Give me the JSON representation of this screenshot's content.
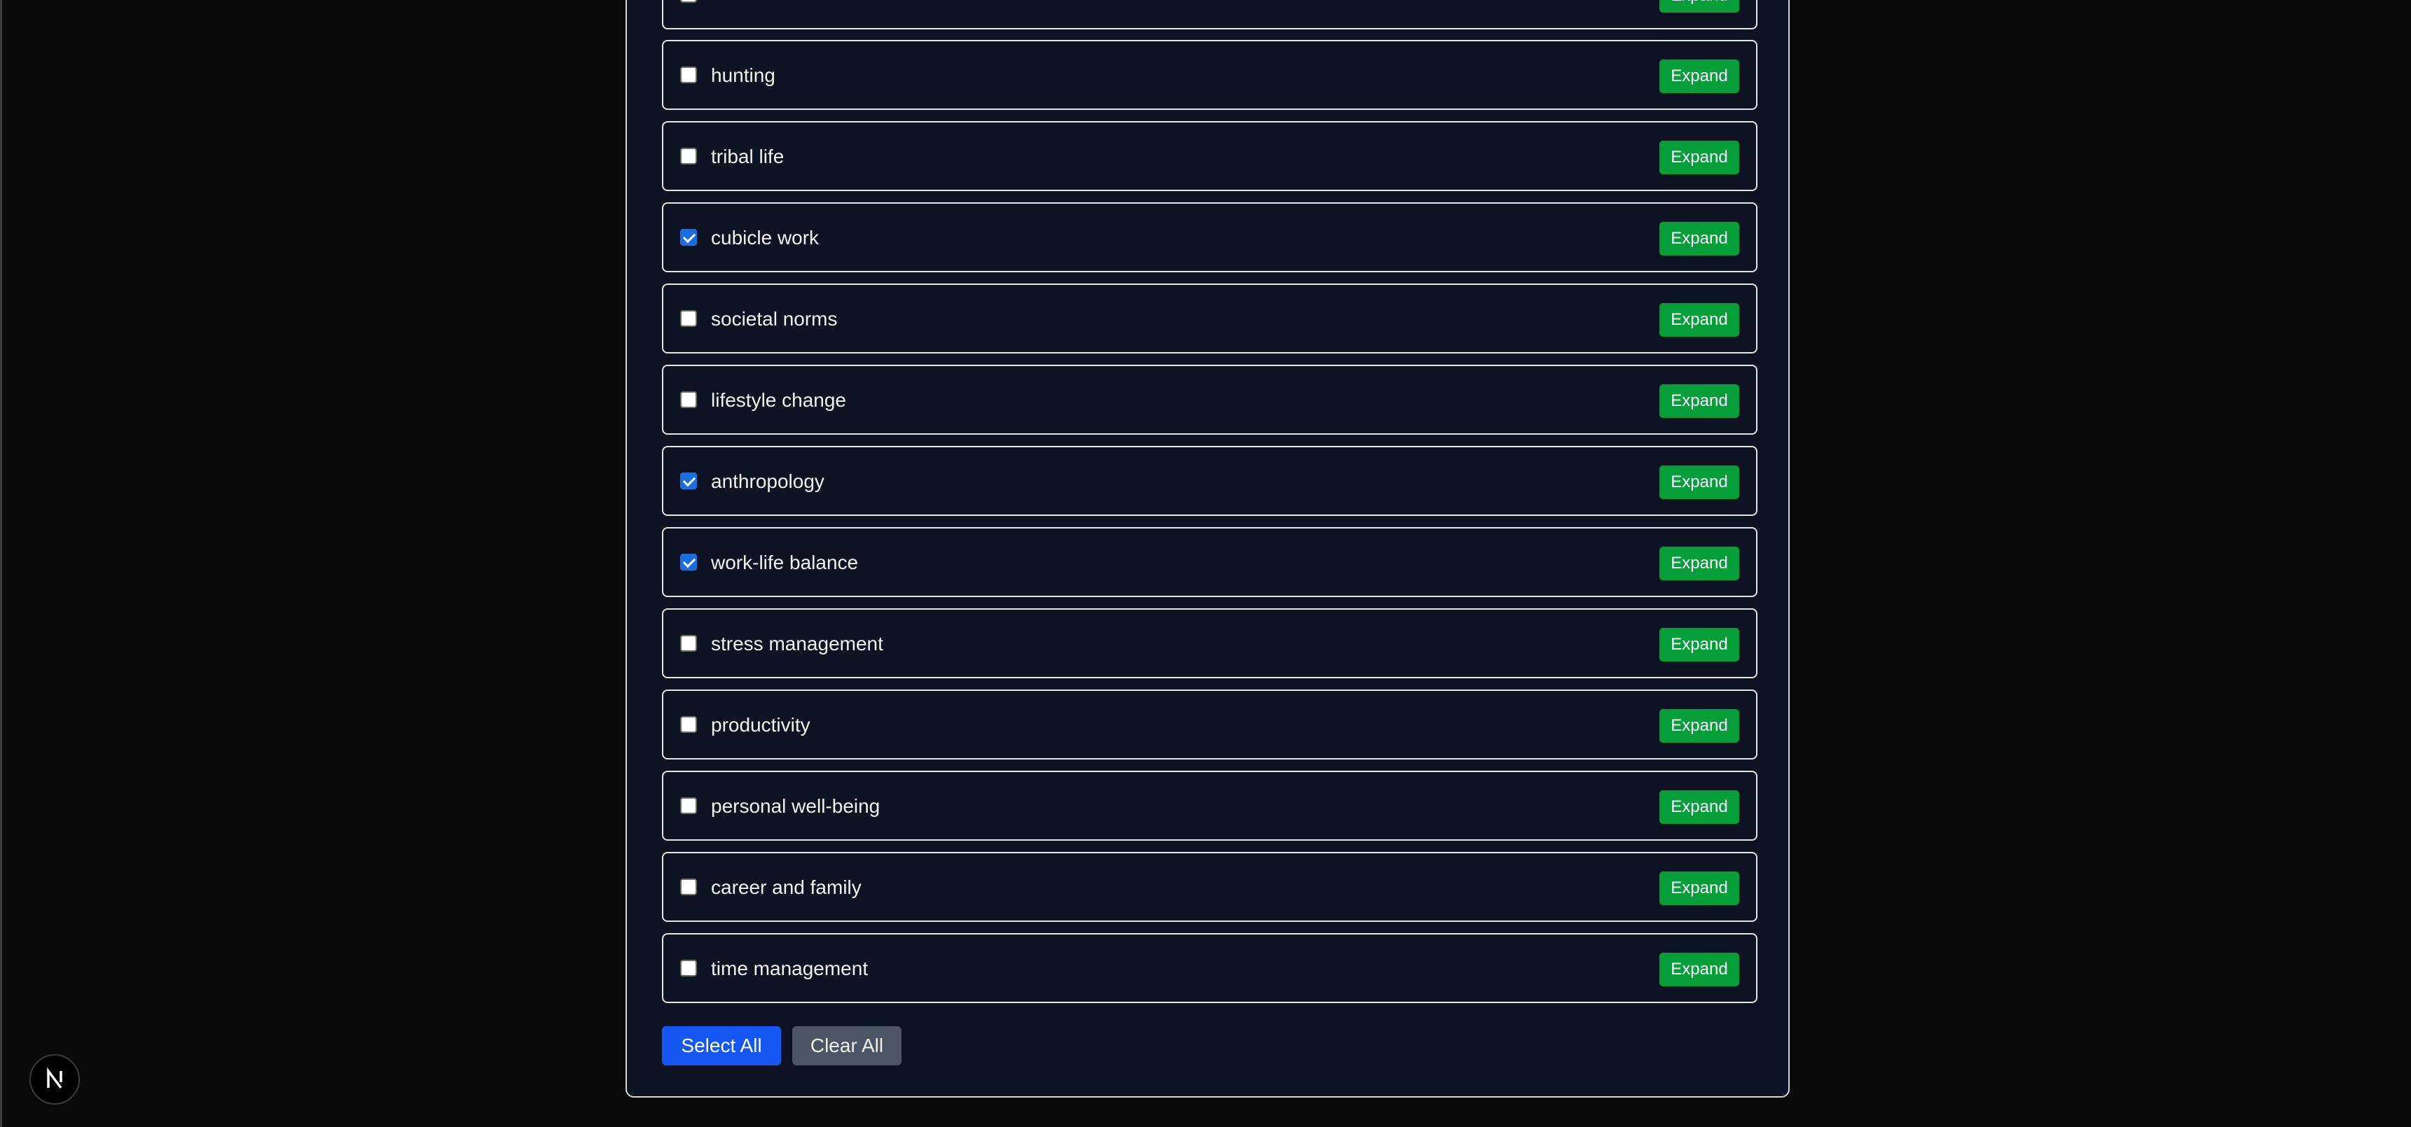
{
  "topics": [
    {
      "label": "",
      "checked": false
    },
    {
      "label": "hunting",
      "checked": false
    },
    {
      "label": "tribal life",
      "checked": false
    },
    {
      "label": "cubicle work",
      "checked": true
    },
    {
      "label": "societal norms",
      "checked": false
    },
    {
      "label": "lifestyle change",
      "checked": false
    },
    {
      "label": "anthropology",
      "checked": true
    },
    {
      "label": "work-life balance",
      "checked": true
    },
    {
      "label": "stress management",
      "checked": false
    },
    {
      "label": "productivity",
      "checked": false
    },
    {
      "label": "personal well-being",
      "checked": false
    },
    {
      "label": "career and family",
      "checked": false
    },
    {
      "label": "time management",
      "checked": false
    }
  ],
  "expand_label": "Expand",
  "actions": {
    "select_all": "Select All",
    "clear_all": "Clear All"
  },
  "colors": {
    "expand": "#069e39",
    "select_all": "#1557f5",
    "clear_all": "#4b5563",
    "checkbox_checked": "#1a6fe0"
  },
  "icons": {
    "badge": "nextjs-logo-icon"
  }
}
